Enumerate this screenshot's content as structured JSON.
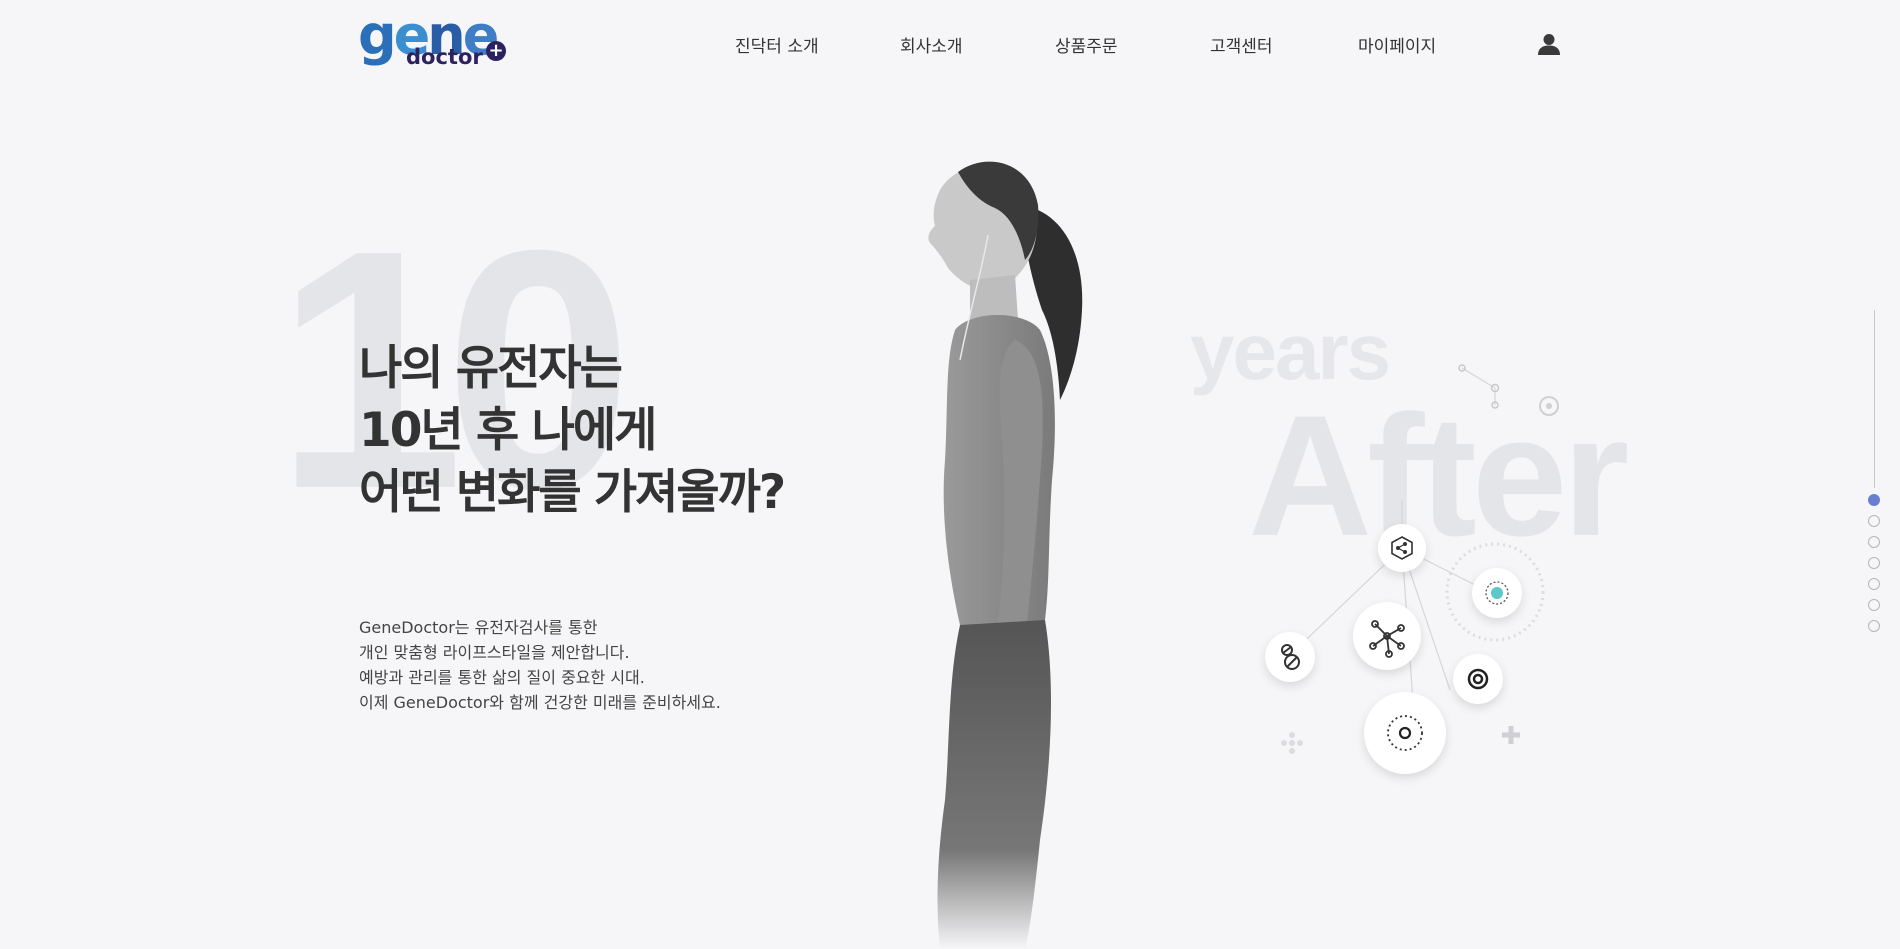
{
  "logo": {
    "wordmark": "gene",
    "sub": "doctor",
    "plus": "+"
  },
  "nav": {
    "items": [
      {
        "label": "진닥터 소개"
      },
      {
        "label": "회사소개"
      },
      {
        "label": "상품주문"
      },
      {
        "label": "고객센터"
      },
      {
        "label": "마이페이지"
      }
    ],
    "user_icon": "user-icon"
  },
  "hero": {
    "big_number": "10",
    "headline": [
      "나의 유전자는",
      "10년 후 나에게",
      "어떤 변화를 가져올까?"
    ],
    "description": [
      "GeneDoctor는 유전자검사를 통한",
      "개인 맞춤형 라이프스타일을 제안합니다.",
      "예방과 관리를 통한 삶의 질이 중요한 시대.",
      "이제 GeneDoctor와 함께 건강한 미래를 준비하세요."
    ],
    "years_text": "years",
    "after_text": "After"
  },
  "pager": {
    "total": 7,
    "active_index": 0
  },
  "colors": {
    "background": "#f6f6f8",
    "accent": "#6b7fd1",
    "logo_dark": "#2c2260",
    "logo_blue": "#2a6fb8",
    "teal": "#5cc8c8"
  }
}
